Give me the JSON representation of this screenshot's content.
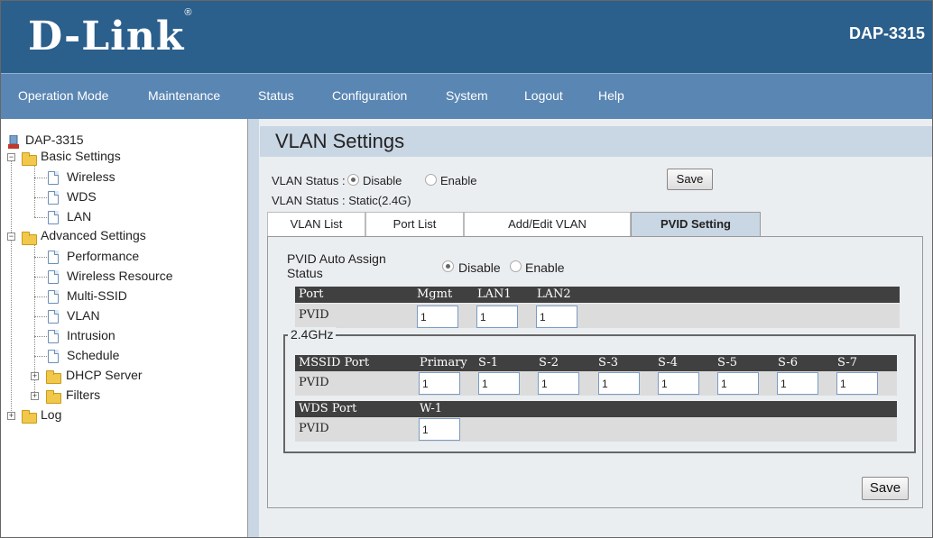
{
  "header": {
    "logo": "D-Link",
    "logo_mark": "®",
    "model": "DAP-3315"
  },
  "nav": [
    "Operation Mode",
    "Maintenance",
    "Status",
    "Configuration",
    "System",
    "Logout",
    "Help"
  ],
  "tree": {
    "root": "DAP-3315",
    "basic": "Basic Settings",
    "basic_items": [
      "Wireless",
      "WDS",
      "LAN"
    ],
    "advanced": "Advanced Settings",
    "advanced_items": [
      "Performance",
      "Wireless Resource",
      "Multi-SSID",
      "VLAN",
      "Intrusion",
      "Schedule"
    ],
    "dhcp": "DHCP Server",
    "filters": "Filters",
    "log": "Log"
  },
  "page": {
    "title": "VLAN Settings",
    "vlan_status_label": "VLAN Status :",
    "disable": "Disable",
    "enable": "Enable",
    "save_top": "Save",
    "vlan_status_info": "VLAN Status : Static(2.4G)",
    "tabs": [
      "VLAN List",
      "Port List",
      "Add/Edit VLAN",
      "PVID Setting"
    ],
    "pvid_auto_label_1": "PVID Auto Assign",
    "pvid_auto_label_2": "Status",
    "port_header": [
      "Port",
      "Mgmt",
      "LAN1",
      "LAN2"
    ],
    "pvid_label": "PVID",
    "port_values": [
      "1",
      "1",
      "1"
    ],
    "band_legend": "2.4GHz",
    "mssid_header": [
      "MSSID Port",
      "Primary",
      "S-1",
      "S-2",
      "S-3",
      "S-4",
      "S-5",
      "S-6",
      "S-7"
    ],
    "mssid_values": [
      "1",
      "1",
      "1",
      "1",
      "1",
      "1",
      "1",
      "1"
    ],
    "wds_header": [
      "WDS Port",
      "W-1"
    ],
    "wds_values": [
      "1"
    ],
    "save_bottom": "Save"
  }
}
